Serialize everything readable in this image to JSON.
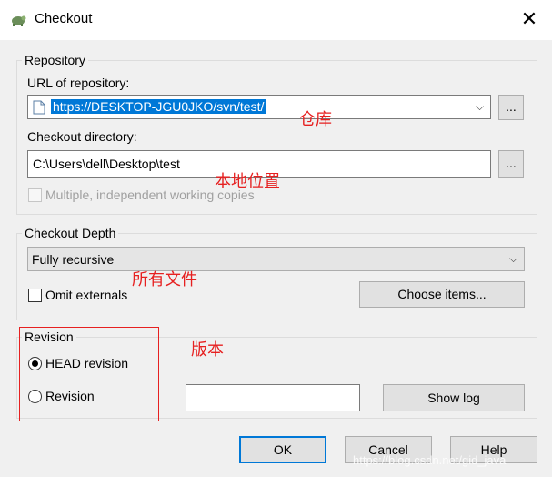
{
  "window": {
    "title": "Checkout",
    "close_glyph": "✕",
    "icon": "tortoise-svn-icon"
  },
  "repository": {
    "group_label": "Repository",
    "url_label": "URL of repository:",
    "url_value": "https://DESKTOP-JGU0JKO/svn/test/",
    "url_browse": "...",
    "dir_label": "Checkout directory:",
    "dir_value": "C:\\Users\\dell\\Desktop\\test",
    "dir_browse": "...",
    "multiple_label": "Multiple, independent working copies"
  },
  "depth": {
    "group_label": "Checkout Depth",
    "selected": "Fully recursive",
    "omit_label": "Omit externals",
    "choose_items": "Choose items..."
  },
  "revision": {
    "group_label": "Revision",
    "head_label": "HEAD revision",
    "revision_label": "Revision",
    "revision_value": "",
    "show_log": "Show log"
  },
  "buttons": {
    "ok": "OK",
    "cancel": "Cancel",
    "help": "Help"
  },
  "annotations": {
    "repo": "仓库",
    "local": "本地位置",
    "all_files": "所有文件",
    "version": "版本"
  },
  "watermark": "https://blog.csdn.net/gid_java"
}
